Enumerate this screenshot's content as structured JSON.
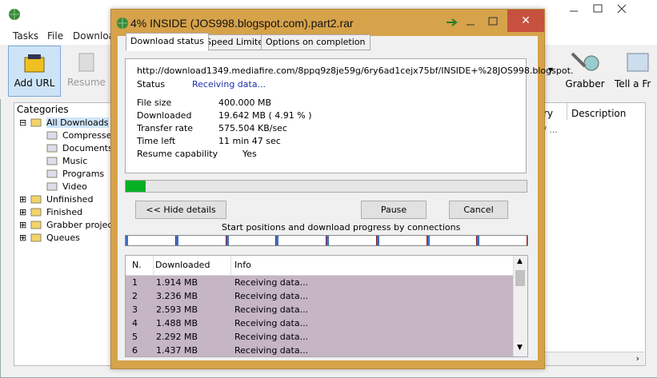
{
  "background": {
    "menu": [
      "Tasks",
      "File",
      "Downloa"
    ],
    "toolbar": {
      "add_url": "Add URL",
      "resume": "Resume",
      "grabber": "Grabber",
      "tell": "Tell a Fr"
    },
    "categories_title": "Categories",
    "tree": [
      {
        "label": "All Downloads",
        "indent": 0
      },
      {
        "label": "Compressed",
        "indent": 1
      },
      {
        "label": "Documents",
        "indent": 1
      },
      {
        "label": "Music",
        "indent": 1
      },
      {
        "label": "Programs",
        "indent": 1
      },
      {
        "label": "Video",
        "indent": 1
      },
      {
        "label": "Unfinished",
        "indent": 0
      },
      {
        "label": "Finished",
        "indent": 0
      },
      {
        "label": "Grabber projects",
        "indent": 0
      },
      {
        "label": "Queues",
        "indent": 0
      }
    ],
    "columns": {
      "partial": "ry",
      "description": "Description"
    },
    "cell_partial": "/ ..."
  },
  "dialog": {
    "title": "4% INSIDE (JOS998.blogspot.com).part2.rar",
    "tabs": [
      "Download status",
      "Speed Limiter",
      "Options on completion"
    ],
    "url": "http://download1349.mediafire.com/8ppq9z8je59g/6ry6ad1cejx75bf/INSIDE+%28JOS998.blogspot.",
    "status_label": "Status",
    "status_value": "Receiving data...",
    "fields": [
      {
        "label": "File size",
        "value": "400.000  MB"
      },
      {
        "label": "Downloaded",
        "value": "19.642  MB  ( 4.91 % )"
      },
      {
        "label": "Transfer rate",
        "value": "575.504  KB/sec"
      },
      {
        "label": "Time left",
        "value": "11 min 47 sec"
      },
      {
        "label": "Resume capability",
        "value": "Yes"
      }
    ],
    "progress_fraction": 0.0491,
    "buttons": {
      "hide": "<< Hide details",
      "pause": "Pause",
      "cancel": "Cancel"
    },
    "connections_caption": "Start positions and download progress by connections",
    "table_headers": [
      "N.",
      "Downloaded",
      "Info"
    ],
    "rows": [
      {
        "n": "1",
        "downloaded": "1.914  MB",
        "info": "Receiving data..."
      },
      {
        "n": "2",
        "downloaded": "3.236  MB",
        "info": "Receiving data..."
      },
      {
        "n": "3",
        "downloaded": "2.593  MB",
        "info": "Receiving data..."
      },
      {
        "n": "4",
        "downloaded": "1.488  MB",
        "info": "Receiving data..."
      },
      {
        "n": "5",
        "downloaded": "2.292  MB",
        "info": "Receiving data..."
      },
      {
        "n": "6",
        "downloaded": "1.437  MB",
        "info": "Receiving data..."
      }
    ],
    "colors": {
      "frame": "#d6a24a",
      "close": "#c7503f",
      "progress": "#06b025",
      "row_bg": "#c5b5c5"
    }
  }
}
